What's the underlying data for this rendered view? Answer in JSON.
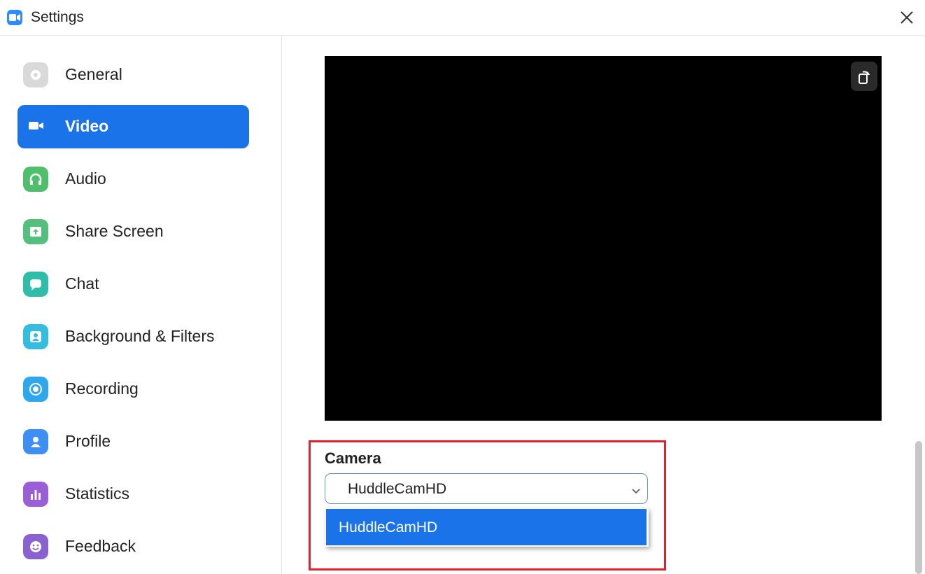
{
  "window": {
    "title": "Settings",
    "app_icon": "video-camera-icon",
    "close_icon": "close-icon"
  },
  "sidebar": {
    "items": [
      {
        "label": "General",
        "icon": "gear-icon",
        "color": "#d9d9d9"
      },
      {
        "label": "Video",
        "icon": "video-camera-icon",
        "color": "#1a73e8",
        "active": true
      },
      {
        "label": "Audio",
        "icon": "headphones-icon",
        "color": "#4fbf6b"
      },
      {
        "label": "Share Screen",
        "icon": "share-screen-icon",
        "color": "#55c07d"
      },
      {
        "label": "Chat",
        "icon": "chat-icon",
        "color": "#2fbda9"
      },
      {
        "label": "Background & Filters",
        "icon": "background-icon",
        "color": "#33bde0"
      },
      {
        "label": "Recording",
        "icon": "record-icon",
        "color": "#2fa7ec"
      },
      {
        "label": "Profile",
        "icon": "profile-icon",
        "color": "#3d8ff5"
      },
      {
        "label": "Statistics",
        "icon": "statistics-icon",
        "color": "#9a5fd6"
      },
      {
        "label": "Feedback",
        "icon": "feedback-icon",
        "color": "#8a61d1"
      }
    ]
  },
  "video": {
    "rotate_icon": "rotate-icon",
    "camera_label": "Camera",
    "camera_selected": "HuddleCamHD",
    "camera_options": [
      "HuddleCamHD"
    ]
  },
  "colors": {
    "accent": "#1a73e8",
    "highlight_border": "#e3202c"
  }
}
